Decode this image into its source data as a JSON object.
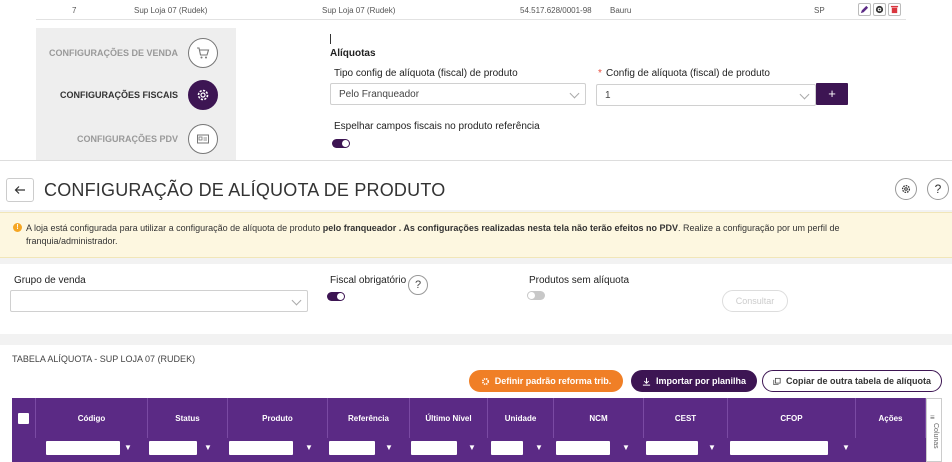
{
  "top_row": {
    "index": "7",
    "name": "Sup Loja 07 (Rudek)",
    "fantasy_name": "Sup Loja 07 (Rudek)",
    "cnpj": "54.517.628/0001-98",
    "city": "Bauru",
    "state": "SP"
  },
  "config_nav": {
    "items": [
      {
        "label": "CONFIGURAÇÕES DE VENDA",
        "icon": "cart-icon"
      },
      {
        "label": "CONFIGURAÇÕES FISCAIS",
        "icon": "gear-icon"
      },
      {
        "label": "CONFIGURAÇÕES PDV",
        "icon": "id-card-icon"
      }
    ]
  },
  "aliquotas": {
    "section_title": "Alíquotas",
    "tipo_label": "Tipo config de alíquota (fiscal) de produto",
    "tipo_value": "Pelo Franqueador",
    "config_required": "*",
    "config_label": "Config de alíquota (fiscal) de produto",
    "config_value": "1",
    "add_label": "+",
    "espelhar_label": "Espelhar campos fiscais no produto referência"
  },
  "header": {
    "title": "CONFIGURAÇÃO DE ALÍQUOTA DE PRODUTO"
  },
  "alert": {
    "part1": "A loja está configurada para utilizar a configuração de alíquota de produto ",
    "bold1": "pelo franqueador . As configurações realizadas nesta tela não terão efeitos no PDV",
    "part2": ". Realize a configuração por um perfil de franquia/administrador."
  },
  "filters": {
    "grupo_label": "Grupo de venda",
    "grupo_value": "",
    "fiscal_label": "Fiscal obrigatório",
    "help": "?",
    "sem_aliquota_label": "Produtos sem alíquota",
    "consultar_label": "Consultar"
  },
  "table": {
    "title": "TABELA ALÍQUOTA - SUP LOJA 07 (RUDEK)",
    "btn_reforma": "Definir padrão reforma trib.",
    "btn_importar": "Importar por planilha",
    "btn_copiar": "Copiar de outra tabela de alíquota",
    "columns": [
      "Código",
      "Status",
      "Produto",
      "Referência",
      "Último Nível",
      "Unidade",
      "NCM",
      "CEST",
      "CFOP",
      "Ações"
    ],
    "colunas_label": "Colunas"
  },
  "colors": {
    "primary": "#3d1553",
    "header_purple": "#5b2a85",
    "orange": "#f07f26",
    "alert_bg": "#fdf7e0",
    "delete_red": "#d9363e"
  }
}
